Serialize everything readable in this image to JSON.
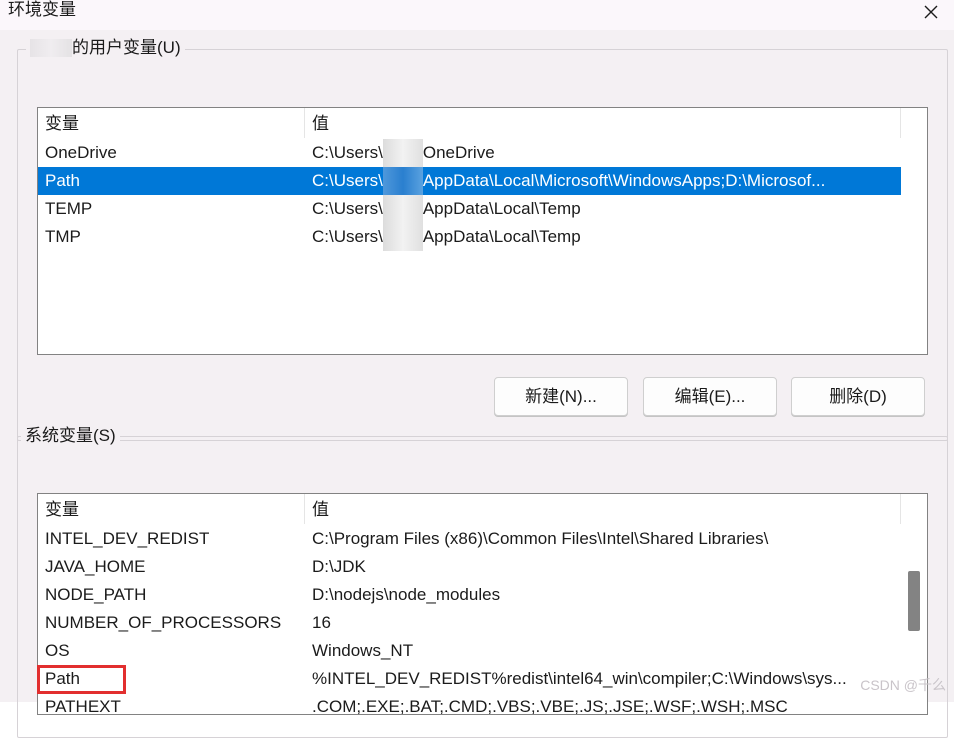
{
  "window": {
    "title": "环境变量",
    "close_symbol": "✕"
  },
  "user_section": {
    "label": "的用户变量(U)",
    "columns": {
      "name": "变量",
      "value": "值"
    },
    "rows": [
      {
        "name": "OneDrive",
        "value_prefix": "C:\\Users\\",
        "value_suffix": "OneDrive",
        "selected": false
      },
      {
        "name": "Path",
        "value_prefix": "C:\\Users\\",
        "value_suffix": "AppData\\Local\\Microsoft\\WindowsApps;D:\\Microsof...",
        "selected": true
      },
      {
        "name": "TEMP",
        "value_prefix": "C:\\Users\\",
        "value_suffix": "AppData\\Local\\Temp",
        "selected": false
      },
      {
        "name": "TMP",
        "value_prefix": "C:\\Users\\",
        "value_suffix": "AppData\\Local\\Temp",
        "selected": false
      }
    ],
    "buttons": {
      "new": "新建(N)...",
      "edit": "编辑(E)...",
      "delete": "删除(D)"
    }
  },
  "system_section": {
    "label": "系统变量(S)",
    "columns": {
      "name": "变量",
      "value": "值"
    },
    "rows": [
      {
        "name": "INTEL_DEV_REDIST",
        "value": "C:\\Program Files (x86)\\Common Files\\Intel\\Shared Libraries\\"
      },
      {
        "name": "JAVA_HOME",
        "value": "D:\\JDK"
      },
      {
        "name": "NODE_PATH",
        "value": "D:\\nodejs\\node_modules"
      },
      {
        "name": "NUMBER_OF_PROCESSORS",
        "value": "16"
      },
      {
        "name": "OS",
        "value": "Windows_NT"
      },
      {
        "name": "Path",
        "value": "%INTEL_DEV_REDIST%redist\\intel64_win\\compiler;C:\\Windows\\sys..."
      },
      {
        "name": "PATHEXT",
        "value": ".COM;.EXE;.BAT;.CMD;.VBS;.VBE;.JS;.JSE;.WSF;.WSH;.MSC"
      }
    ]
  },
  "watermark": "CSDN @千么",
  "colors": {
    "selection": "#0078d7",
    "highlight": "#e22f2f"
  }
}
